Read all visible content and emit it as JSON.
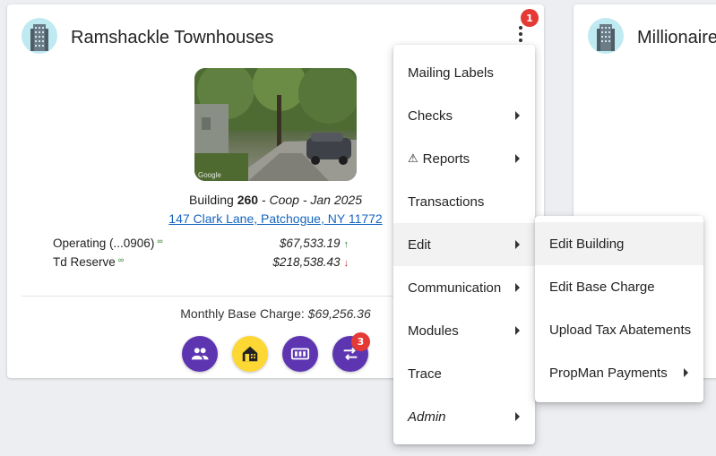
{
  "card": {
    "title": "Ramshackle Townhouses",
    "menu_badge": "1",
    "photo_watermark": "Google",
    "building_prefix": "Building ",
    "building_number": "260",
    "building_suffix": " - Coop - Jan 2025",
    "address": "147 Clark Lane, Patchogue, NY 11772",
    "accounts": [
      {
        "name": "Operating (...0906)",
        "amount": "$67,533.19",
        "trend": "up"
      },
      {
        "name": "Td Reserve",
        "amount": "$218,538.43",
        "trend": "down"
      }
    ],
    "base_charge_label": "Monthly Base Charge: ",
    "base_charge_value": "$69,256.36",
    "actions": [
      {
        "icon": "people-icon",
        "color": "#5e35b1"
      },
      {
        "icon": "home-icon",
        "color": "#fdd835"
      },
      {
        "icon": "meter-icon",
        "color": "#5e35b1"
      },
      {
        "icon": "transfer-icon",
        "color": "#5e35b1",
        "badge": "3"
      }
    ]
  },
  "card2": {
    "title": "Millionaire"
  },
  "menu": {
    "items": [
      {
        "label": "Mailing Labels",
        "submenu": false
      },
      {
        "label": "Checks",
        "submenu": true
      },
      {
        "label": "Reports",
        "submenu": true,
        "icon": "warning-icon"
      },
      {
        "label": "Transactions",
        "submenu": false
      },
      {
        "label": "Edit",
        "submenu": true,
        "active": true
      },
      {
        "label": "Communication",
        "submenu": true
      },
      {
        "label": "Modules",
        "submenu": true
      },
      {
        "label": "Trace",
        "submenu": false
      },
      {
        "label": "Admin",
        "submenu": true,
        "italic": true
      }
    ]
  },
  "submenu": {
    "items": [
      {
        "label": "Edit Building",
        "active": true
      },
      {
        "label": "Edit Base Charge"
      },
      {
        "label": "Upload Tax Abatements"
      },
      {
        "label": "PropMan Payments",
        "submenu": true
      }
    ]
  },
  "colors": {
    "accent_purple": "#5e35b1",
    "accent_yellow": "#fdd835",
    "badge_red": "#e53935",
    "link_blue": "#1565c0",
    "up_green": "#2e7d32",
    "down_red": "#c62828"
  }
}
